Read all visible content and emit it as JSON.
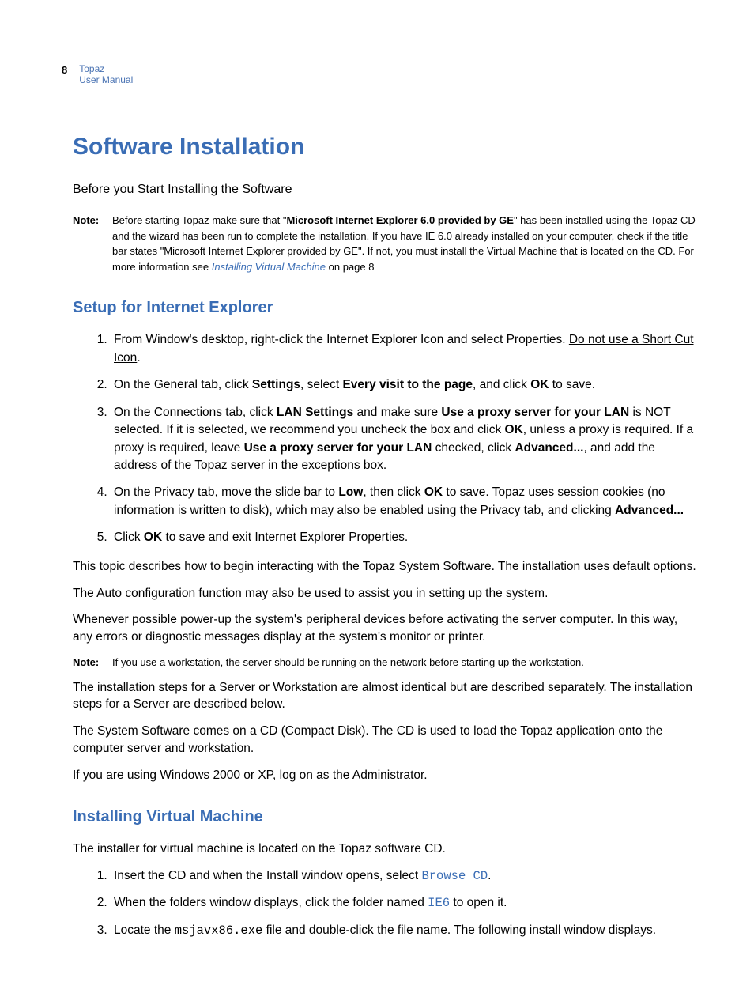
{
  "header": {
    "page_number": "8",
    "doc_line1": "Topaz",
    "doc_line2": "User Manual"
  },
  "title": "Software Installation",
  "subtitle": "Before you Start Installing the Software",
  "note1": {
    "label": "Note:",
    "t1": "Before starting Topaz make sure that \"",
    "bold1": "Microsoft Internet Explorer 6.0 provided by GE",
    "t2": "\" has been installed using the Topaz CD and the wizard has been run to complete the installation. If you have IE 6.0 already installed on your computer, check if the title bar states \"Microsoft Internet Explorer provided by GE\". If not, you must install the Virtual Machine that is located on the CD. For more information see ",
    "link": "Installing Virtual Machine",
    "t3": " on page 8"
  },
  "section_ie": {
    "heading": "Setup for Internet Explorer",
    "step1_a": "From Window's desktop, right-click the Internet Explorer Icon and select Properties. ",
    "step1_u": "Do not use a Short Cut Icon",
    "step1_c": ".",
    "step2_a": "On the General tab, click ",
    "step2_b1": "Settings",
    "step2_b": ", select ",
    "step2_b2": "Every visit to the page",
    "step2_c": ", and click ",
    "step2_b3": "OK",
    "step2_d": " to save.",
    "step3_a": "On the Connections tab, click ",
    "step3_b1": "LAN Settings",
    "step3_b": " and make sure ",
    "step3_b2": "Use a proxy server for your LAN",
    "step3_c": " is ",
    "step3_u": "NOT",
    "step3_d": " selected. If it is selected, we recommend you uncheck the box and click ",
    "step3_b3": "OK",
    "step3_e": ", unless a proxy is required. If a proxy is required, leave ",
    "step3_b4": "Use a proxy server for your LAN",
    "step3_f": " checked, click ",
    "step3_b5": "Advanced...",
    "step3_g": ", and add the address of the Topaz server in the exceptions box.",
    "step4_a": "On the Privacy tab, move the slide bar to ",
    "step4_b1": "Low",
    "step4_b": ", then click ",
    "step4_b2": "OK",
    "step4_c": " to save. Topaz uses session cookies (no information is written to disk), which may also be enabled using the Privacy tab, and clicking ",
    "step4_b3": "Advanced...",
    "step5_a": "Click ",
    "step5_b1": "OK",
    "step5_b": " to save and exit Internet Explorer Properties."
  },
  "paras": {
    "p1": "This topic describes how to begin interacting with the Topaz System Software. The installation uses default options.",
    "p2": "The Auto configuration function may also be used to assist you in setting up the system.",
    "p3": "Whenever possible power-up the system's peripheral devices before activating the server computer. In this way, any errors or diagnostic messages display at the system's monitor or printer."
  },
  "note2": {
    "label": "Note:",
    "text": "If you use a workstation, the server should be running on the network before starting up the workstation."
  },
  "paras2": {
    "p4": "The installation steps for a Server or Workstation are almost identical but are described separately. The installation steps for a Server are described below.",
    "p5": "The System Software comes on a CD (Compact Disk). The CD is used to load the Topaz application onto the computer server and workstation.",
    "p6": "If you are using Windows 2000 or XP, log on as the Administrator."
  },
  "section_vm": {
    "heading": "Installing Virtual Machine",
    "intro": "The installer for virtual machine is located on the Topaz software CD.",
    "step1_a": "Insert the CD and when the Install window opens, select ",
    "step1_m": "Browse CD",
    "step1_b": ".",
    "step2_a": "When the folders window displays, click the folder named ",
    "step2_m": "IE6",
    "step2_b": " to open it.",
    "step3_a": "Locate the ",
    "step3_m": "msjavx86.exe",
    "step3_b": " file and double-click the file name. The following install window displays."
  }
}
